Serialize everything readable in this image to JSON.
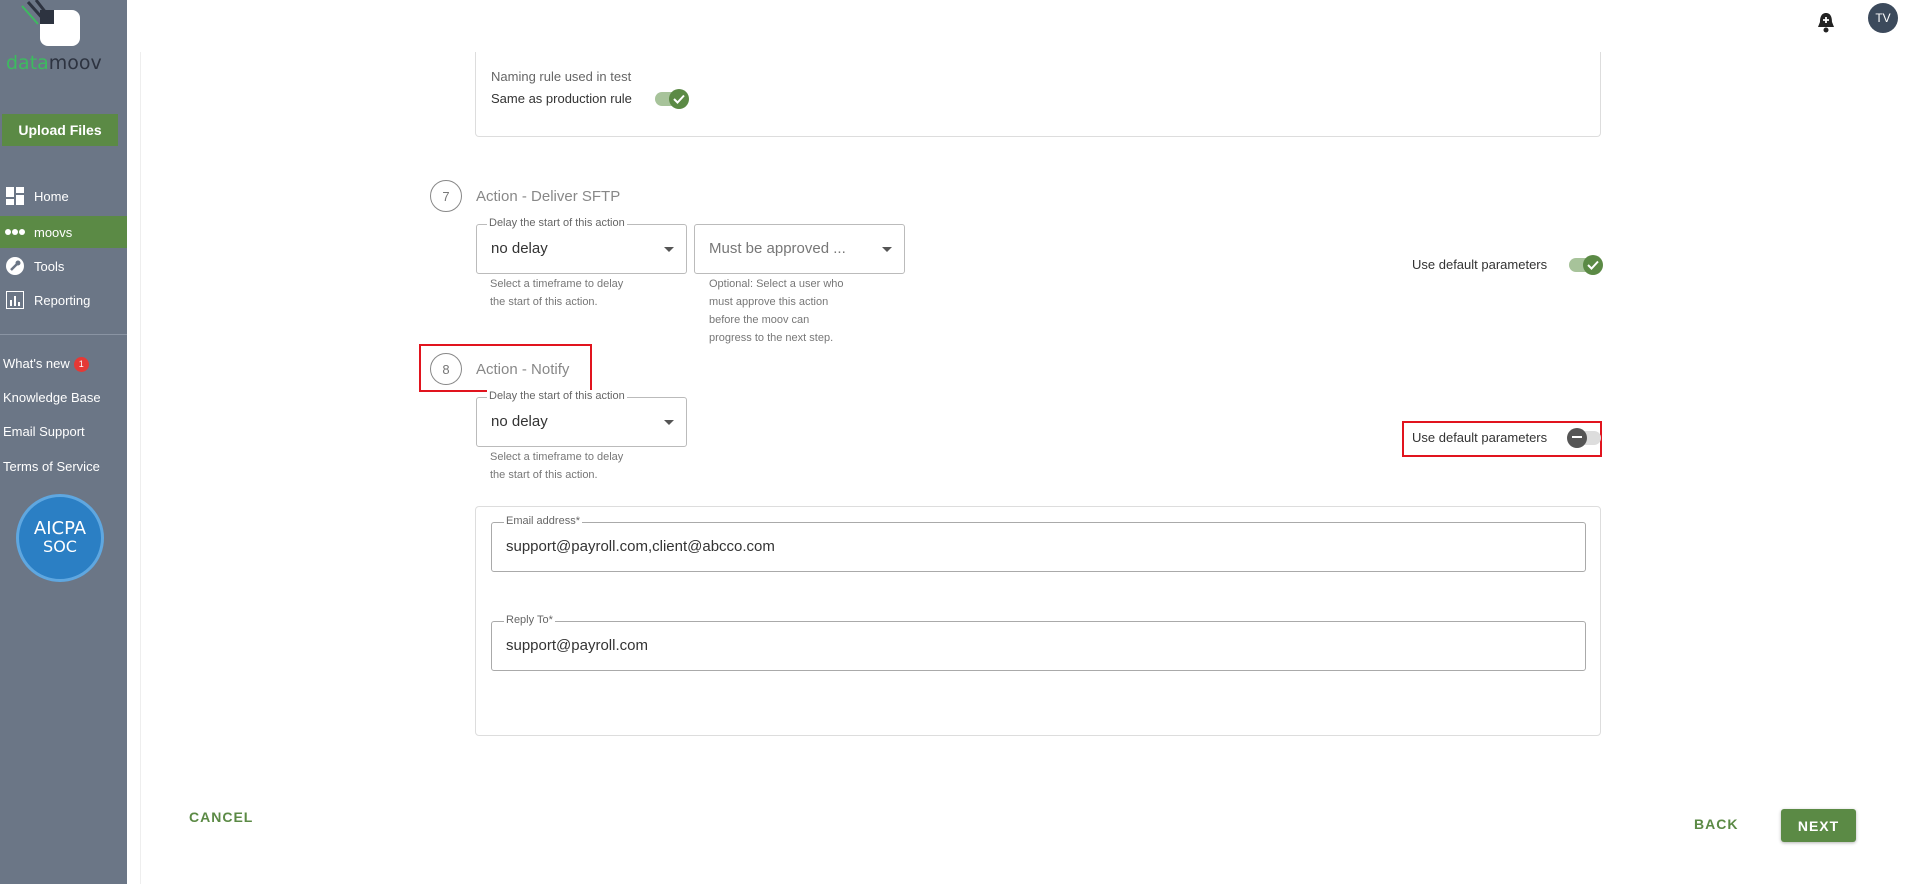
{
  "brand": {
    "logo_part1": "data",
    "logo_part2": "moov"
  },
  "sidebar": {
    "upload_label": "Upload Files",
    "nav": [
      {
        "label": "Home",
        "icon": "dashboard-icon"
      },
      {
        "label": "moovs",
        "icon": "dots-icon",
        "active": true
      },
      {
        "label": "Tools",
        "icon": "wrench-icon"
      },
      {
        "label": "Reporting",
        "icon": "chart-icon"
      }
    ],
    "links": {
      "whats_new": "What's new",
      "whats_new_count": "1",
      "knowledge_base": "Knowledge Base",
      "email_support": "Email Support",
      "terms": "Terms of Service"
    },
    "soc_badge": {
      "line1": "AICPA",
      "line2": "SOC"
    }
  },
  "header": {
    "avatar_initials": "TV"
  },
  "naming": {
    "label": "Naming rule used in test",
    "toggle_label": "Same as production rule"
  },
  "step7": {
    "number": "7",
    "title": "Action - Deliver SFTP",
    "delay_legend": "Delay the start of this action",
    "delay_value": "no delay",
    "delay_helper_1": "Select a timeframe to delay",
    "delay_helper_2": "the start of this action.",
    "approver_placeholder": "Must be approved ...",
    "approver_helper_1": "Optional: Select a user who",
    "approver_helper_2": "must approve this action",
    "approver_helper_3": "before the moov can",
    "approver_helper_4": "progress to the next step.",
    "default_label": "Use default parameters"
  },
  "step8": {
    "number": "8",
    "title": "Action - Notify",
    "delay_legend": "Delay the start of this action",
    "delay_value": "no delay",
    "delay_helper_1": "Select a timeframe to delay",
    "delay_helper_2": "the start of this action.",
    "default_label": "Use default parameters",
    "email_legend": "Email address*",
    "email_value": "support@payroll.com,client@abcco.com",
    "reply_legend": "Reply To*",
    "reply_value": "support@payroll.com"
  },
  "footer": {
    "cancel": "CANCEL",
    "back": "BACK",
    "next": "NEXT"
  },
  "colors": {
    "sidebar": "#6b7686",
    "accent": "#5b8a45",
    "highlight": "#e1141e"
  }
}
